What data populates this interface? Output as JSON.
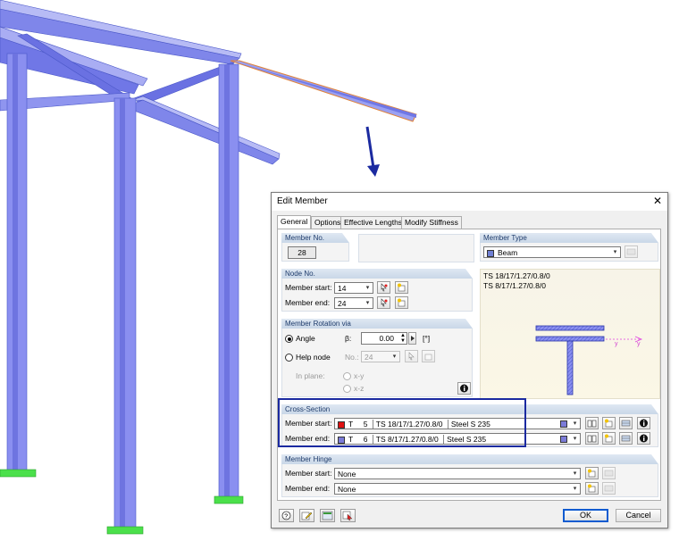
{
  "dialog": {
    "title": "Edit Member",
    "tabs": [
      "General",
      "Options",
      "Effective Lengths",
      "Modify Stiffness"
    ],
    "member_no": {
      "label": "Member No.",
      "value": "28"
    },
    "member_type": {
      "label": "Member Type",
      "value": "Beam",
      "color": "#6f7fd4"
    },
    "node_no": {
      "label": "Node No.",
      "start_label": "Member start:",
      "start_value": "14",
      "end_label": "Member end:",
      "end_value": "24"
    },
    "rotation": {
      "label": "Member Rotation via",
      "angle_label": "Angle",
      "beta_label": "β:",
      "beta_value": "0.00",
      "unit": "[°]",
      "help_node_label": "Help node",
      "no_label": "No.:",
      "no_value": "24",
      "in_plane_label": "In plane:",
      "plane_opt1": "x-y",
      "plane_opt2": "x-z"
    },
    "preview": {
      "line1": "TS 18/17/1.27/0.8/0",
      "line2": "TS 8/17/1.27/0.8/0",
      "axis_y": "y"
    },
    "cross_section": {
      "label": "Cross-Section",
      "start_label": "Member start:",
      "start": {
        "color": "#e01010",
        "glyph": "T",
        "no": "5",
        "name": "TS 18/17/1.27/0.8/0",
        "material": "Steel S 235"
      },
      "end_label": "Member end:",
      "end": {
        "color": "#7b7bd8",
        "glyph": "T",
        "no": "6",
        "name": "TS 8/17/1.27/0.8/0",
        "material": "Steel S 235"
      }
    },
    "hinge": {
      "label": "Member Hinge",
      "start_label": "Member start:",
      "start_value": "None",
      "end_label": "Member end:",
      "end_value": "None"
    },
    "buttons": {
      "ok": "OK",
      "cancel": "Cancel"
    }
  },
  "colors": {
    "accent": "#1b2aa0",
    "steel": "#8a8ff0",
    "support": "#4be04b"
  }
}
